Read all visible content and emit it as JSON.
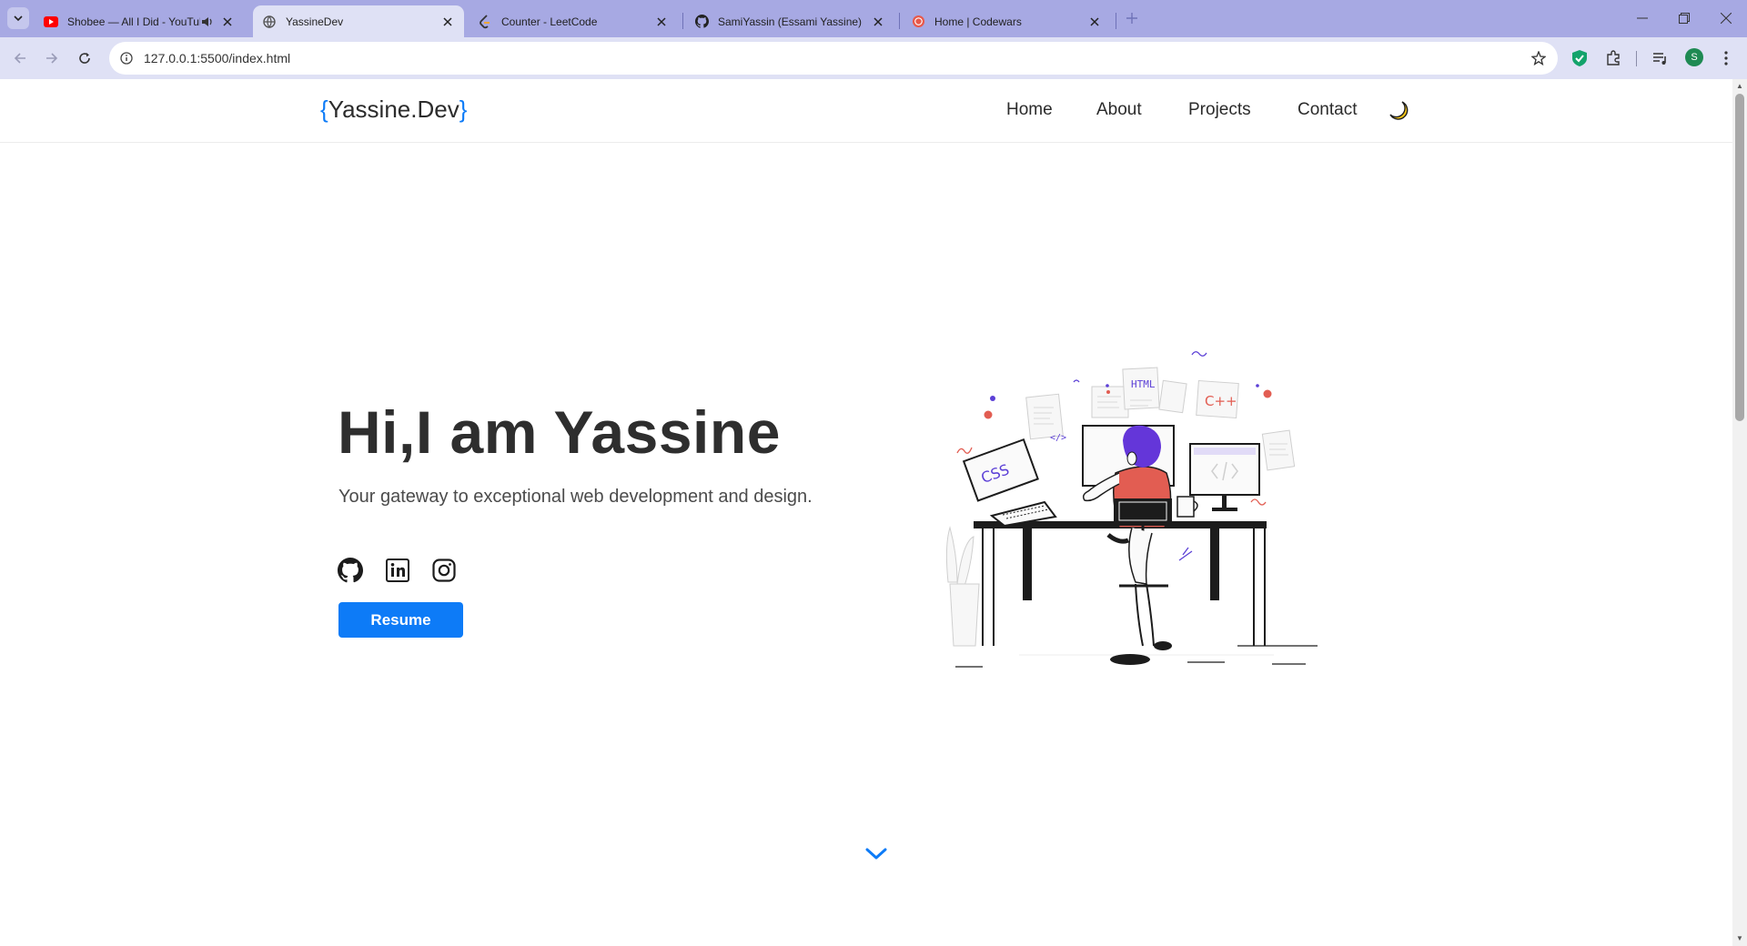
{
  "browser": {
    "tabs": [
      {
        "title": "Shobee — All I Did - YouTube",
        "favicon": "youtube-icon",
        "active": false,
        "audio": true
      },
      {
        "title": "YassineDev",
        "favicon": "globe-icon",
        "active": true,
        "audio": false
      },
      {
        "title": "Counter - LeetCode",
        "favicon": "leetcode-icon",
        "active": false,
        "audio": false
      },
      {
        "title": "SamiYassin (Essami Yassine)",
        "favicon": "github-icon",
        "active": false,
        "audio": false
      },
      {
        "title": "Home | Codewars",
        "favicon": "codewars-icon",
        "active": false,
        "audio": false
      }
    ],
    "url": "127.0.0.1:5500/index.html",
    "profile_initial": "S",
    "colors": {
      "tabstrip": "#a7a9e3",
      "toolbar": "#dfe1f5",
      "accent": "#0d7bf7"
    }
  },
  "site": {
    "brand": {
      "open_brace": "{",
      "name": "Yassine.Dev",
      "close_brace": "}"
    },
    "nav": [
      "Home",
      "About",
      "Projects",
      "Contact"
    ],
    "theme_toggle_icon": "moon-icon",
    "hero": {
      "title": "Hi,I am Yassine",
      "subtitle": "Your gateway to exceptional web development and design.",
      "social": [
        "github-icon",
        "linkedin-icon",
        "instagram-icon"
      ],
      "resume_label": "Resume"
    },
    "illustration_labels": {
      "html": "HTML",
      "css": "CSS",
      "cpp": "C++",
      "code": "</>"
    },
    "scroll_icon": "chevron-down-icon"
  }
}
